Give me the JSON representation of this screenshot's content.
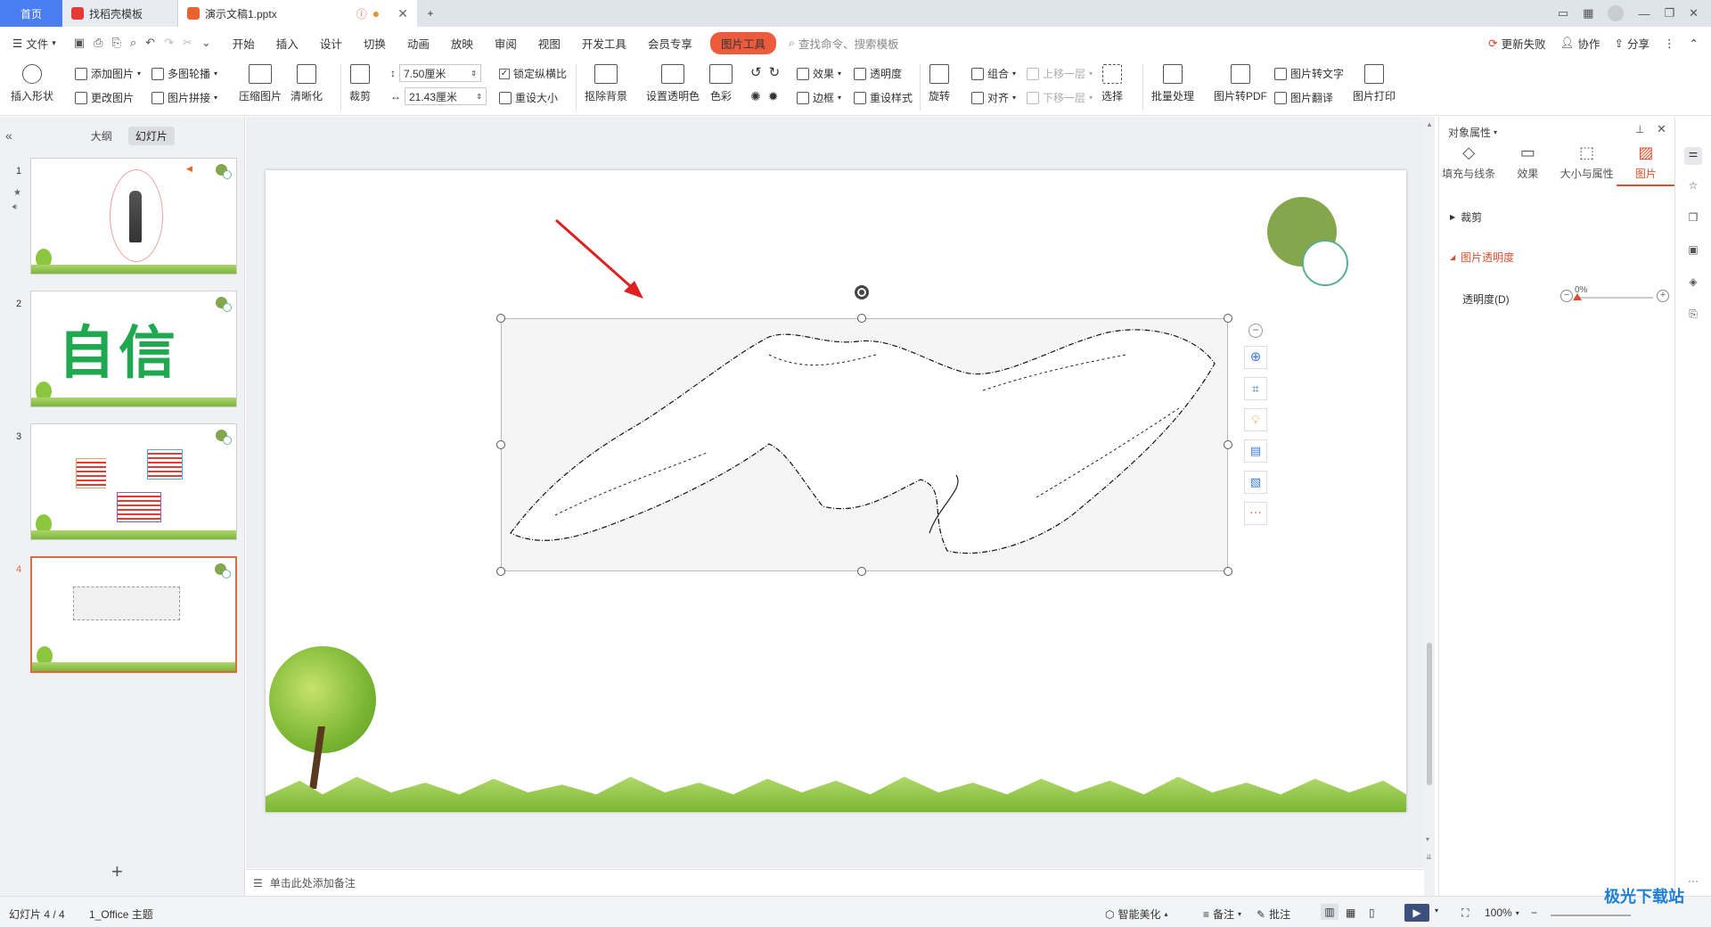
{
  "tabs": {
    "home": "首页",
    "template": "找稻壳模板",
    "document": "演示文稿1.pptx"
  },
  "menu": {
    "file": "文件",
    "items": [
      "开始",
      "插入",
      "设计",
      "切换",
      "动画",
      "放映",
      "审阅",
      "视图",
      "开发工具",
      "会员专享"
    ],
    "active_tool": "图片工具",
    "search_placeholder": "查找命令、搜索模板",
    "update_failed": "更新失败",
    "collaborate": "协作",
    "share": "分享"
  },
  "ribbon": {
    "insert_shape": "插入形状",
    "add_picture": "添加图片",
    "change_picture": "更改图片",
    "multi_contour": "多图轮播",
    "picture_merge": "图片拼接",
    "compress": "压缩图片",
    "sharpen": "清晰化",
    "crop": "裁剪",
    "height": "7.50厘米",
    "width": "21.43厘米",
    "lock_ratio": "锁定纵横比",
    "reset_size": "重设大小",
    "remove_bg": "抠除背景",
    "set_transparent": "设置透明色",
    "color": "色彩",
    "effect": "效果",
    "border": "边框",
    "transparency": "透明度",
    "reset_style": "重设样式",
    "rotate": "旋转",
    "group": "组合",
    "align": "对齐",
    "bring_forward": "上移一层",
    "send_backward": "下移一层",
    "select": "选择",
    "batch": "批量处理",
    "to_pdf": "图片转PDF",
    "to_text": "图片转文字",
    "translate": "图片翻译",
    "print": "图片打印"
  },
  "left_panel": {
    "tab_outline": "大纲",
    "tab_slides": "幻灯片",
    "slides": [
      {
        "num": "1"
      },
      {
        "num": "2",
        "title_text": "自信"
      },
      {
        "num": "3"
      },
      {
        "num": "4"
      }
    ],
    "selected_slide": 4
  },
  "notes_placeholder": "单击此处添加备注",
  "right_panel": {
    "title": "对象属性",
    "tabs": [
      "填充与线条",
      "效果",
      "大小与属性",
      "图片"
    ],
    "active_tab": "图片",
    "section_crop": "裁剪",
    "section_transparency": "图片透明度",
    "transparency_label": "透明度(D)",
    "transparency_value": "0%",
    "transparency_level": 0
  },
  "status": {
    "slide_counter": "幻灯片 4 / 4",
    "theme": "1_Office 主题",
    "smart_beautify": "智能美化",
    "notes": "备注",
    "comments": "批注",
    "zoom": "100%"
  },
  "colors": {
    "accent": "#ec5c3c",
    "home_tab": "#4a7df0",
    "slide_circle": "#86a64e",
    "arrow": "#e02020",
    "selected_border": "#e06a3b"
  },
  "watermark": "极光下载站"
}
